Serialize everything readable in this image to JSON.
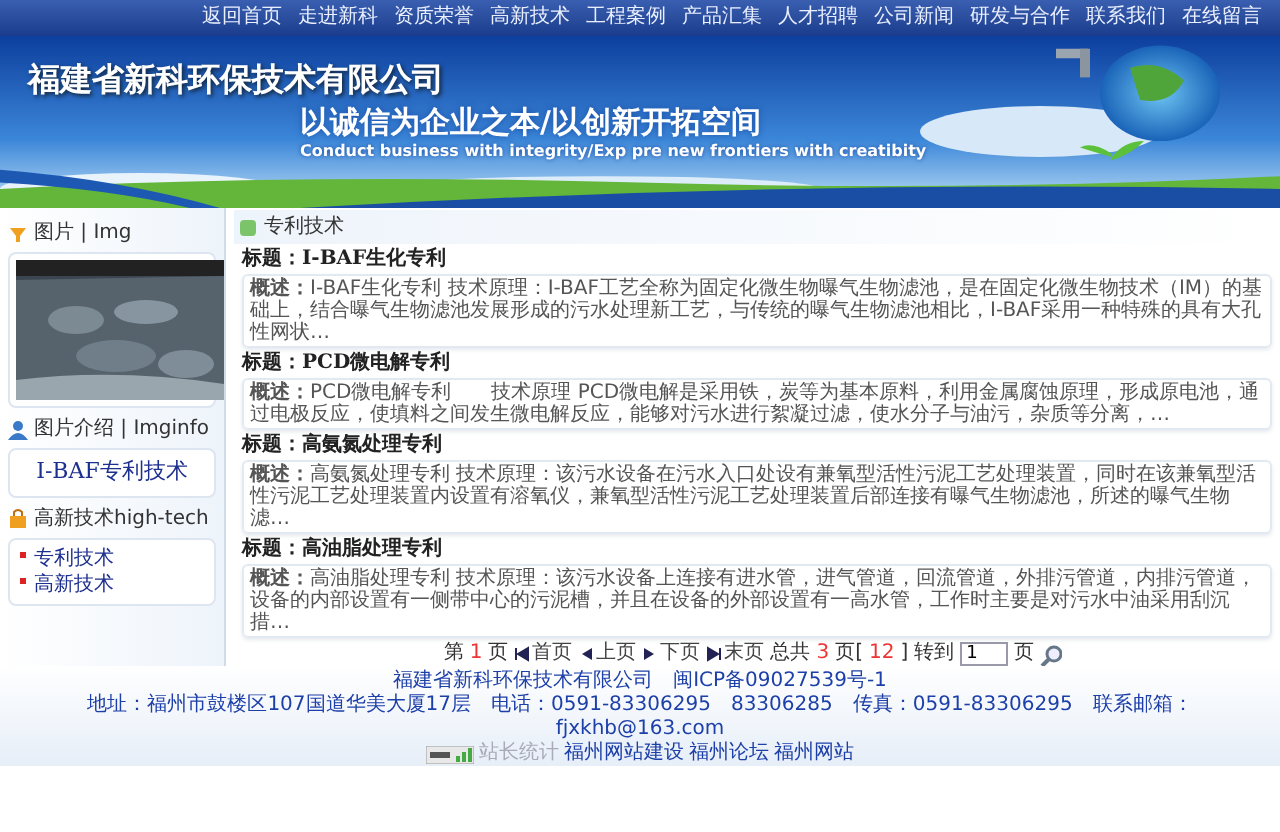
{
  "nav": {
    "items": [
      "返回首页",
      "走进新科",
      "资质荣誉",
      "高新技术",
      "工程案例",
      "产品汇集",
      "人才招聘",
      "公司新闻",
      "研发与合作",
      "联系我们",
      "在线留言"
    ]
  },
  "banner": {
    "company": "福建省新科环保技术有限公司",
    "slogan": "以诚信为企业之本/以创新开拓空间",
    "slogan_en": "Conduct business with integrity/Exp pre new frontiers with creatibity"
  },
  "sidebar": {
    "sections": [
      {
        "title": "图片 | Img",
        "kind": "picture"
      },
      {
        "title": "图片介绍 | Imginfo",
        "kind": "text",
        "text": "I-BAF专利技术"
      },
      {
        "title": "高新技术high-tech",
        "kind": "links",
        "links": [
          "专利技术",
          "高新技术"
        ]
      }
    ]
  },
  "content": {
    "heading": "专利技术",
    "articles": [
      {
        "title": "标题：I-BAF生化专利",
        "summary": "**概述：**I-BAF生化专利 技术原理：I-BAF工艺全称为固定化微生物曝气生物滤池，是在固定化微生物技术（IM）的基础上，结合曝气生物滤池发展形成的污水处理新工艺，与传统的曝气生物滤池相比，I-BAF采用一种特殊的具有大孔性网状…"
      },
      {
        "title": "标题：PCD微电解专利",
        "summary": "**概述：**PCD微电解专利　　技术原理 PCD微电解是采用铁，炭等为基本原料，利用金属腐蚀原理，形成原电池，通过电极反应，使填料之间发生微电解反应，能够对污水进行絮凝过滤，使水分子与油污，杂质等分离，…"
      },
      {
        "title": "标题：高氨氮处理专利",
        "summary": "**概述：**高氨氮处理专利 技术原理：该污水设备在污水入口处设有兼氧型活性污泥工艺处理装置，同时在该兼氧型活性污泥工艺处理装置内设置有溶氧仪，兼氧型活性污泥工艺处理装置后部连接有曝气生物滤池，所述的曝气生物滤…"
      },
      {
        "title": "标题：高油脂处理专利",
        "summary": "**概述：**高油脂处理专利 技术原理：该污水设备上连接有进水管，进气管道，回流管道，外排污管道，内排污管道，设备的内部设置有一侧带中心的污泥槽，并且在设备的外部设置有一高水管，工作时主要是对污水中油采用刮沉措…"
      }
    ]
  },
  "pager": {
    "parts": [
      {
        "kind": "text",
        "text": "第"
      },
      {
        "kind": "num",
        "text": "1"
      },
      {
        "kind": "text",
        "text": "页"
      },
      {
        "kind": "first",
        "text": "首页"
      },
      {
        "kind": "prev",
        "text": "上页"
      },
      {
        "kind": "next",
        "text": "下页"
      },
      {
        "kind": "last",
        "text": "末页"
      },
      {
        "kind": "text",
        "text": "总共"
      },
      {
        "kind": "num",
        "text": "3"
      },
      {
        "kind": "text",
        "text": "页["
      },
      {
        "kind": "num",
        "text": "12"
      },
      {
        "kind": "text",
        "text": "]"
      },
      {
        "kind": "text",
        "text": "转到"
      },
      {
        "kind": "input",
        "text": "1"
      },
      {
        "kind": "text",
        "text": "页"
      },
      {
        "kind": "search"
      }
    ]
  },
  "footer": {
    "lines": [
      "福建省新科环保技术有限公司　闽ICP备09027539号-1",
      "地址：福州市鼓楼区107国道华美大厦17层　电话：0591-83306295　83306285　传真：0591-83306295　联系邮箱：fjxkhb@163.com"
    ],
    "stats_label": "站长统计",
    "links": [
      "福州网站建设",
      "福州论坛",
      "福州网站"
    ]
  }
}
